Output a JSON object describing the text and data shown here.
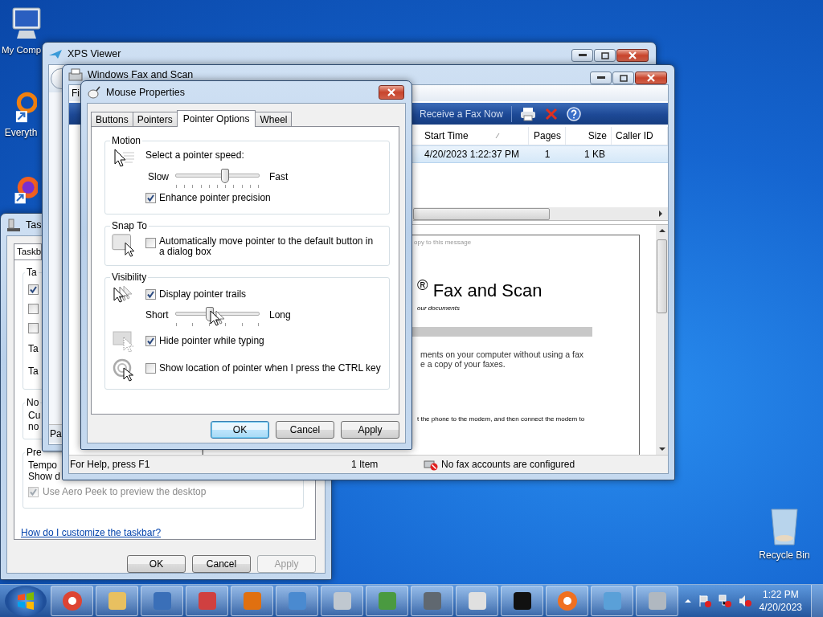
{
  "desktop_icons": [
    {
      "label": "My Comp"
    },
    {
      "label": "Everyth"
    },
    {
      "label": "Recycle Bin"
    }
  ],
  "taskbar_properties": {
    "title": "Tas",
    "tab": "Taskb",
    "groups": [
      {
        "heading": "Ta",
        "rows": [
          {
            "kind": "checkbox",
            "checked": true,
            "disabled": false
          },
          {
            "kind": "checkbox",
            "checked": false,
            "disabled": false
          },
          {
            "kind": "checkbox",
            "checked": false,
            "disabled": false
          },
          {
            "kind": "label",
            "text": "Ta"
          },
          {
            "kind": "label",
            "text": "Ta"
          }
        ]
      },
      {
        "heading": "No",
        "rows": [
          {
            "kind": "line",
            "text": "Cu"
          },
          {
            "kind": "line",
            "text": "no"
          }
        ]
      },
      {
        "heading": "Pre",
        "rows": [
          {
            "kind": "line",
            "text": "Tempo"
          },
          {
            "kind": "line",
            "text": "Show d"
          },
          {
            "kind": "checkbox",
            "checked": true,
            "disabled": true,
            "label": "Use Aero Peek to preview the desktop"
          }
        ]
      }
    ],
    "link": "How do I customize the taskbar?",
    "buttons": [
      {
        "label": "OK",
        "disabled": false
      },
      {
        "label": "Cancel",
        "disabled": false
      },
      {
        "label": "Apply",
        "disabled": true
      }
    ]
  },
  "xps_viewer": {
    "title": "XPS Viewer",
    "pane_label": "Pa"
  },
  "fax": {
    "title": "Windows Fax and Scan",
    "menu": "Fi",
    "toolbar": "Receive a Fax Now",
    "columns": [
      "Start Time",
      "Pages",
      "Size",
      "Caller ID"
    ],
    "rows": [
      {
        "selected": true,
        "start_time": "4/20/2023 1:22:37 PM",
        "pages": "1",
        "size": "1 KB"
      }
    ],
    "preview": {
      "note": "opy to this message",
      "heading": "$^{®}$ Fax and Scan",
      "subtitle": "our documents",
      "paragraph": [
        "ments on your computer without using a fax",
        "e a copy of your faxes."
      ],
      "step": "t the phone to the modem, and then connect the modem to"
    },
    "status": [
      "For Help, press F1",
      "1 Item",
      "No fax accounts are configured"
    ]
  },
  "mouse": {
    "title": "Mouse Properties",
    "tabs": [
      {
        "label": "Buttons",
        "selected": false
      },
      {
        "label": "Pointers",
        "selected": false
      },
      {
        "label": "Pointer Options",
        "selected": true
      },
      {
        "label": "Wheel",
        "selected": false
      }
    ],
    "motion": {
      "heading": "Motion",
      "prompt": "Select a pointer speed:",
      "min": "Slow",
      "max": "Fast",
      "level": 0.59,
      "precision": {
        "label": "Enhance pointer precision",
        "checked": true
      }
    },
    "snap": {
      "heading": "Snap To",
      "label": "Automatically move pointer to the default button in a dialog box",
      "checked": false
    },
    "visibility": {
      "heading": "Visibility",
      "trails": {
        "label": "Display pointer trails",
        "checked": true,
        "min": "Short",
        "max": "Long",
        "level": 0.41
      },
      "hide": {
        "label": "Hide pointer while typing",
        "checked": true
      },
      "ctrl": {
        "label": "Show location of pointer when I press the CTRL key",
        "checked": false
      }
    },
    "buttons": [
      {
        "label": "OK",
        "default": true
      },
      {
        "label": "Cancel",
        "default": false
      },
      {
        "label": "Apply",
        "default": false
      }
    ]
  },
  "clock": {
    "time": "1:22 PM",
    "date": "4/20/2023"
  }
}
